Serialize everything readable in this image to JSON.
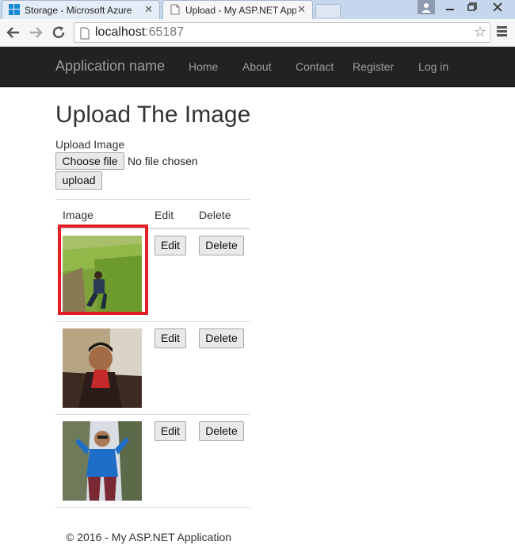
{
  "browser": {
    "tabs": [
      {
        "title": "Storage - Microsoft Azure",
        "icon": "windows-logo-icon",
        "active": false
      },
      {
        "title": "Upload - My ASP.NET App",
        "icon": "page-icon",
        "active": true
      }
    ],
    "close_glyph": "✕",
    "address": {
      "host": "localhost",
      "port": ":65187"
    }
  },
  "navbar": {
    "brand": "Application name",
    "links": [
      "Home",
      "About",
      "Contact",
      "Register",
      "Log in"
    ]
  },
  "page": {
    "title": "Upload The Image",
    "upload_label": "Upload Image",
    "choose_file": "Choose file",
    "no_file": "No file chosen",
    "upload_button": "upload"
  },
  "table": {
    "headers": [
      "Image",
      "Edit",
      "Delete"
    ],
    "rows": [
      {
        "edit": "Edit",
        "delete": "Delete",
        "highlighted": true
      },
      {
        "edit": "Edit",
        "delete": "Delete",
        "highlighted": false
      },
      {
        "edit": "Edit",
        "delete": "Delete",
        "highlighted": false
      }
    ]
  },
  "footer": "© 2016 - My ASP.NET Application",
  "colors": {
    "navbar_bg": "#222222",
    "nav_text": "#9d9d9d",
    "highlight": "#e21d25"
  }
}
